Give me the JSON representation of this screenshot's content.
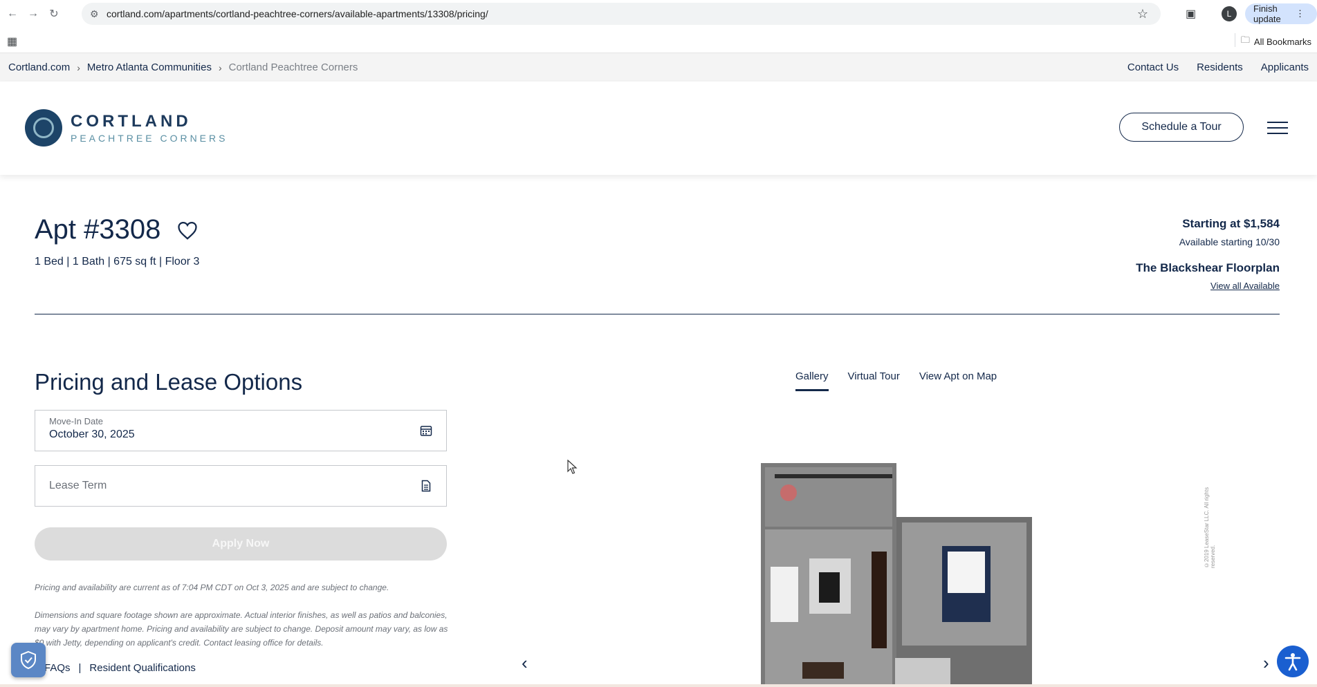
{
  "browser": {
    "url": "cortland.com/apartments/cortland-peachtree-corners/available-apartments/13308/pricing/",
    "profile_initial": "L",
    "finish_update_label": "Finish update",
    "all_bookmarks_label": "All Bookmarks"
  },
  "breadcrumb": {
    "items": [
      "Cortland.com",
      "Metro Atlanta Communities",
      "Cortland Peachtree Corners"
    ]
  },
  "top_links": [
    "Contact Us",
    "Residents",
    "Applicants"
  ],
  "header": {
    "logo_title": "CORTLAND",
    "logo_subtitle": "PEACHTREE CORNERS",
    "tour_button": "Schedule a Tour"
  },
  "apartment": {
    "title": "Apt #3308",
    "specs": "1 Bed | 1 Bath | 675 sq ft | Floor 3",
    "price": "Starting at $1,584",
    "availability": "Available starting 10/30",
    "floorplan": "The Blackshear Floorplan",
    "view_all": "View all Available"
  },
  "pricing": {
    "title": "Pricing and Lease Options",
    "move_in_label": "Move-In Date",
    "move_in_value": "October 30, 2025",
    "lease_term_placeholder": "Lease Term",
    "apply_button": "Apply Now",
    "disclaimer_1": "Pricing and availability are current as of 7:04 PM CDT on Oct 3, 2025 and are subject to change.",
    "disclaimer_2": "Dimensions and square footage shown are approximate. Actual interior finishes, as well as patios and balconies, may vary by apartment home. Pricing and availability are subject to change. Deposit amount may vary, as low as $0 with Jetty, depending on applicant's credit. Contact leasing office for details.",
    "faq_link": "FAQs",
    "qualifications_link": "Resident Qualifications",
    "link_separator": "|"
  },
  "gallery": {
    "tabs": [
      "Gallery",
      "Virtual Tour",
      "View Apt on Map"
    ],
    "active_tab": "Gallery",
    "watermark": "©2019 LeaseStar LLC. All rights reserved."
  },
  "colors": {
    "navy": "#13284a",
    "accessibility_blue": "#1a5fd0",
    "disabled_button": "#dcdcdc"
  }
}
